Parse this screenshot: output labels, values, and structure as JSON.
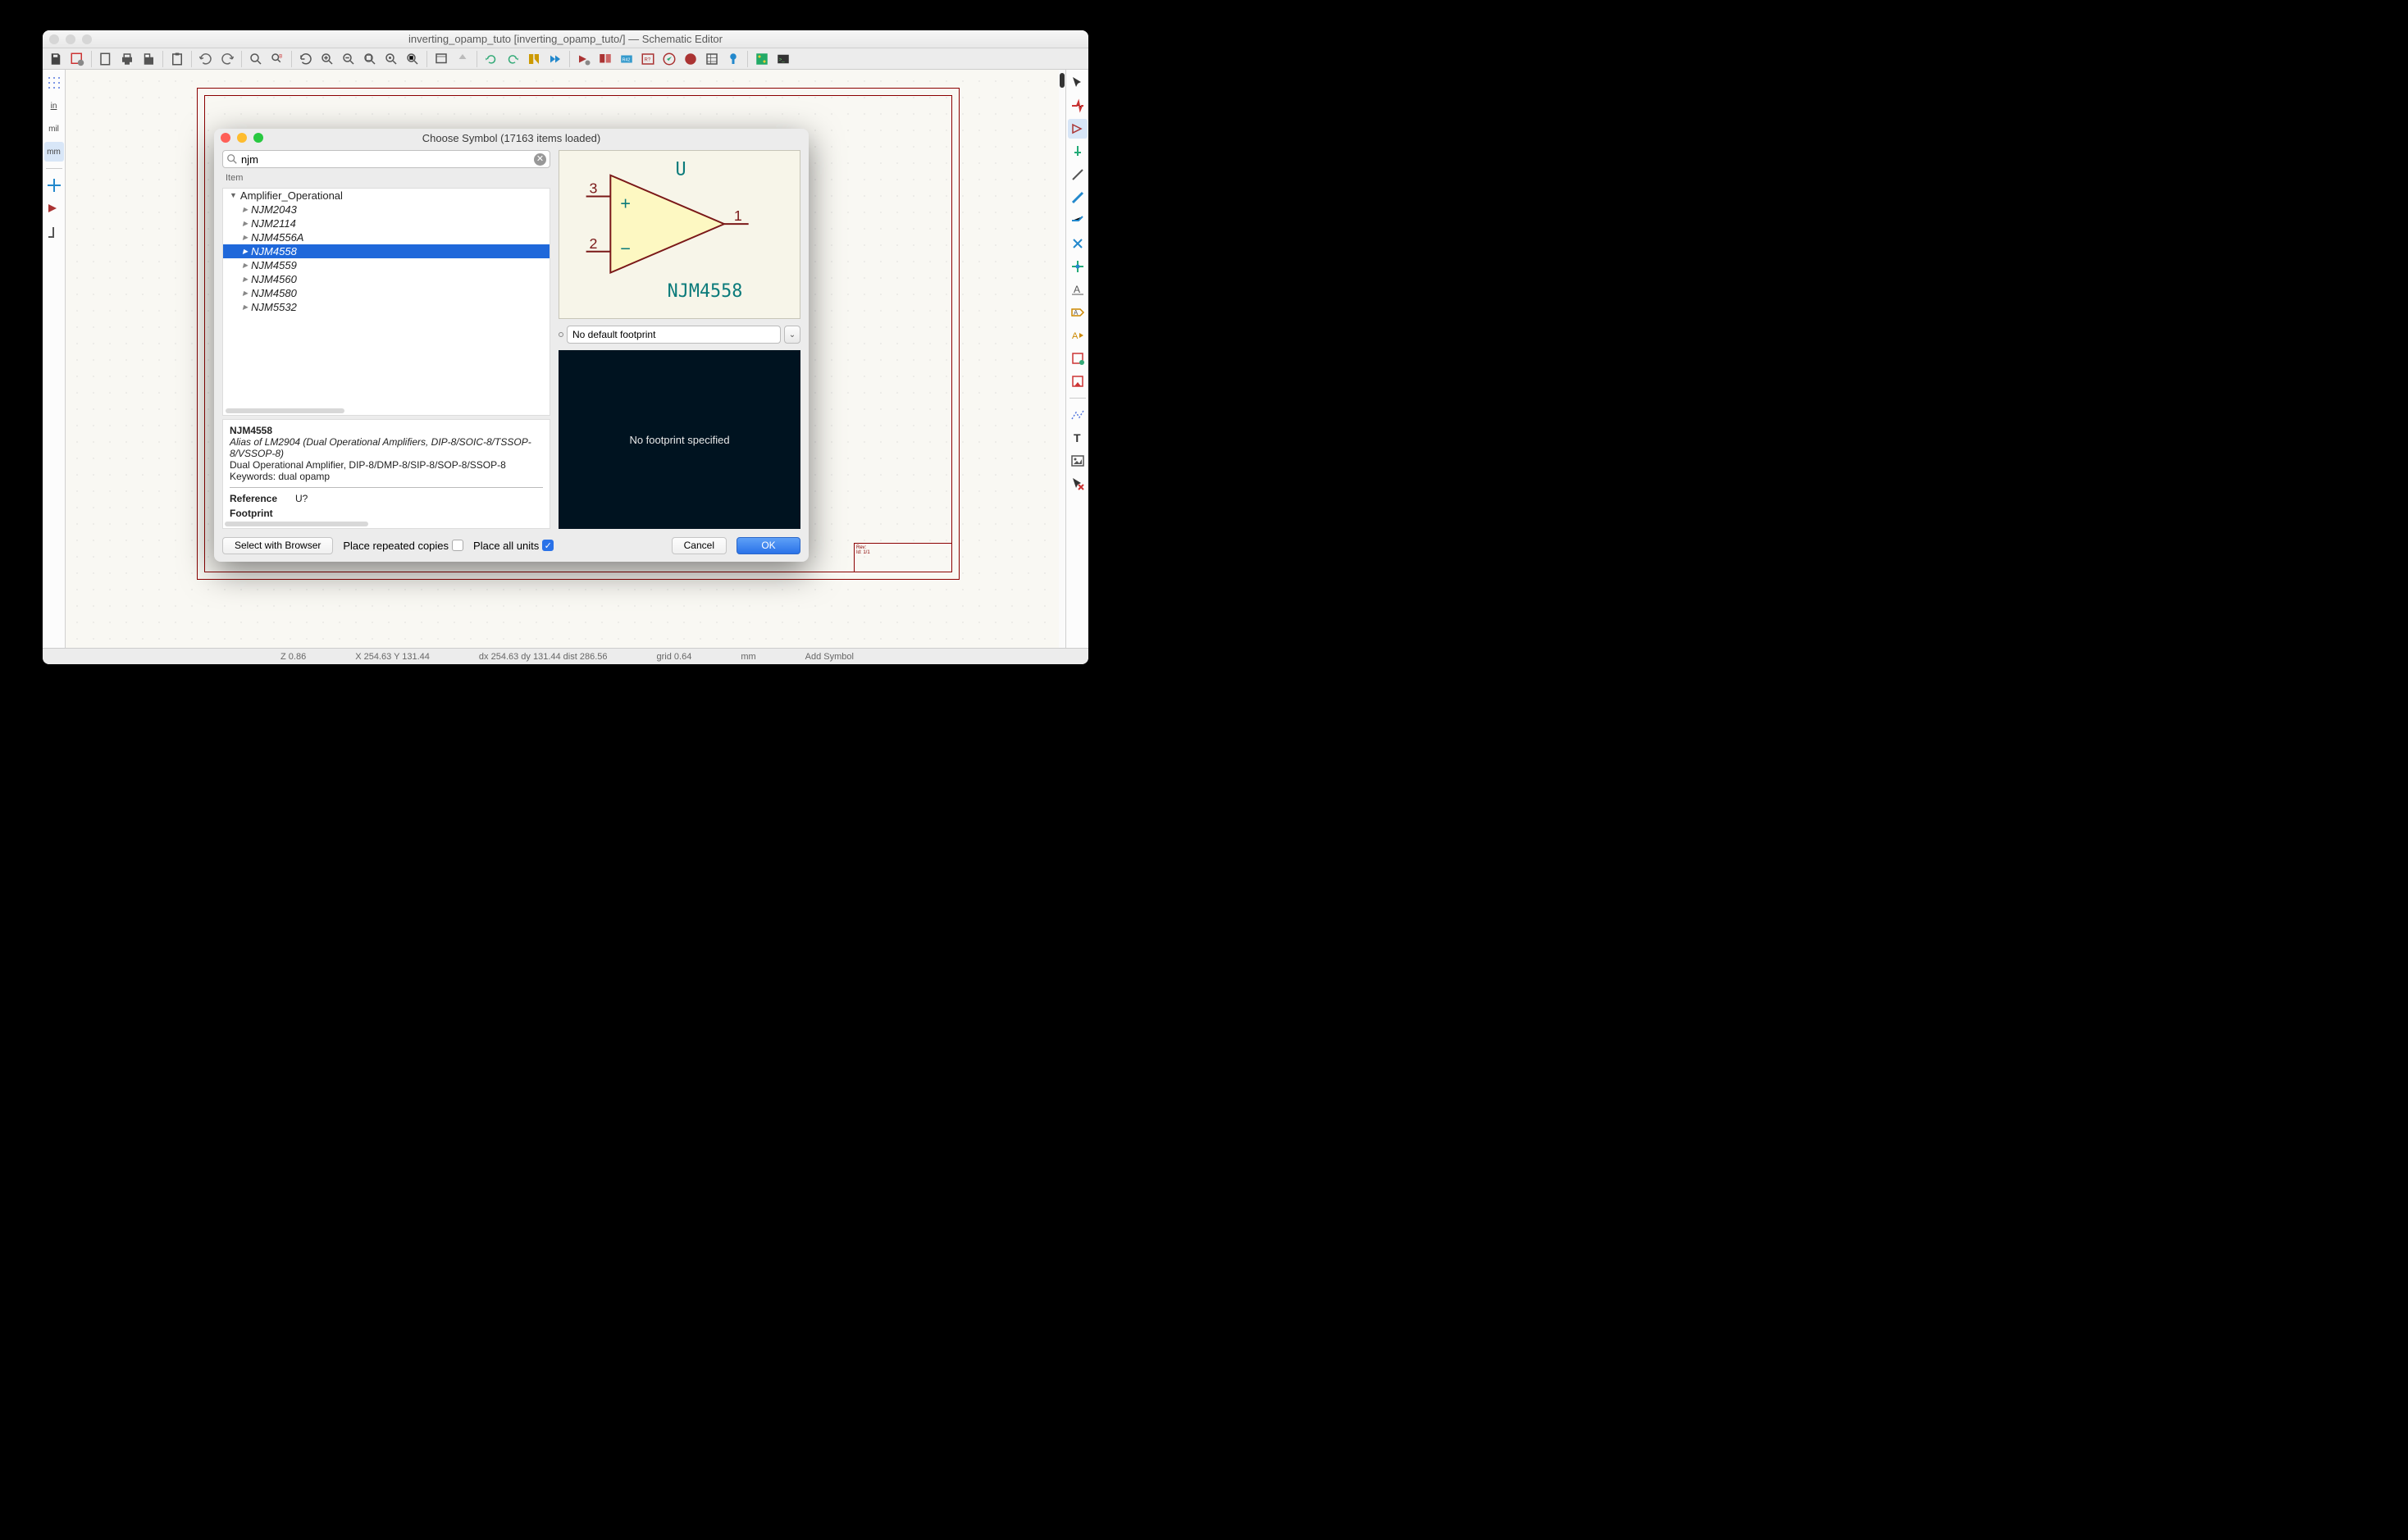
{
  "window": {
    "title": "inverting_opamp_tuto [inverting_opamp_tuto/] — Schematic Editor"
  },
  "left_tools": [
    "grid",
    "in",
    "mil",
    "mm",
    "",
    "snap",
    "sym",
    "origin"
  ],
  "right_tools": [
    "select",
    "net-highlight",
    "probe",
    "sym",
    "power",
    "wire",
    "bus",
    "nc",
    "junction",
    "label",
    "global-label",
    "hier-label",
    "text",
    "bitmap",
    "delete"
  ],
  "statusbar": {
    "z": "Z 0.86",
    "xy": "X 254.63  Y 131.44",
    "dxy": "dx 254.63  dy 131.44  dist 286.56",
    "grid": "grid 0.64",
    "unit": "mm",
    "mode": "Add Symbol"
  },
  "sheet": {
    "rev": "Rev:",
    "id": "Id: 1/1"
  },
  "dialog": {
    "title": "Choose Symbol (17163 items loaded)",
    "search_value": "njm",
    "item_header": "Item",
    "library": "Amplifier_Operational",
    "parts": [
      "NJM2043",
      "NJM2114",
      "NJM4556A",
      "NJM4558",
      "NJM4559",
      "NJM4560",
      "NJM4580",
      "NJM5532"
    ],
    "selected_index": 3,
    "desc": {
      "name": "NJM4558",
      "alias": "Alias of LM2904 (Dual Operational Amplifiers, DIP-8/SOIC-8/TSSOP-8/VSSOP-8)",
      "line2": "Dual Operational Amplifier, DIP-8/DMP-8/SIP-8/SOP-8/SSOP-8",
      "keywords": "Keywords: dual opamp",
      "ref_label": "Reference",
      "ref_value": "U?",
      "fp_label": "Footprint"
    },
    "preview": {
      "ref": "U",
      "value": "NJM4558",
      "pins": {
        "p1": "1",
        "p2": "2",
        "p3": "3"
      }
    },
    "footprint_combo": "No default footprint",
    "fp_preview": "No footprint specified",
    "buttons": {
      "browser": "Select with Browser",
      "repeat_label": "Place repeated copies",
      "allunits_label": "Place all units",
      "cancel": "Cancel",
      "ok": "OK"
    }
  }
}
